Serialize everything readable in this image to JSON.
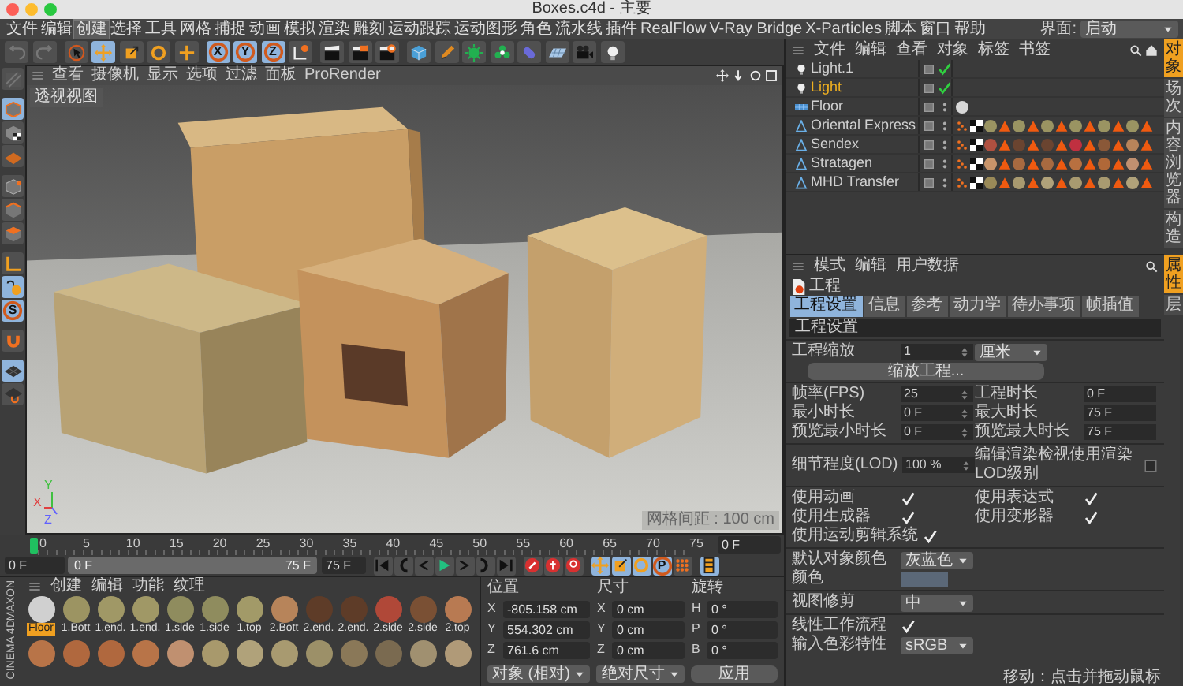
{
  "window": {
    "title": "Boxes.c4d - 主要"
  },
  "menu": [
    {
      "label": "文件",
      "selected": false
    },
    {
      "label": "编辑",
      "selected": false
    },
    {
      "label": "创建",
      "selected": true
    },
    {
      "label": "选择",
      "selected": false
    },
    {
      "label": "工具",
      "selected": false
    },
    {
      "label": "网格",
      "selected": false
    },
    {
      "label": "捕捉",
      "selected": false
    },
    {
      "label": "动画",
      "selected": false
    },
    {
      "label": "模拟",
      "selected": false
    },
    {
      "label": "渲染",
      "selected": false
    },
    {
      "label": "雕刻",
      "selected": false
    },
    {
      "label": "运动跟踪",
      "selected": false
    },
    {
      "label": "运动图形",
      "selected": false
    },
    {
      "label": "角色",
      "selected": false
    },
    {
      "label": "流水线",
      "selected": false
    },
    {
      "label": "插件",
      "selected": false
    },
    {
      "label": "RealFlow",
      "selected": false
    },
    {
      "label": "V-Ray Bridge",
      "selected": false
    },
    {
      "label": "X-Particles",
      "selected": false
    },
    {
      "label": "脚本",
      "selected": false
    },
    {
      "label": "窗口",
      "selected": false
    },
    {
      "label": "帮助",
      "selected": false
    }
  ],
  "layout_selector": {
    "label": "界面:",
    "value": "启动"
  },
  "toolbar": [
    [
      {
        "kind": "undo",
        "selected": false
      },
      {
        "kind": "redo",
        "selected": false
      }
    ],
    [
      {
        "kind": "select",
        "selected": false
      },
      {
        "kind": "move",
        "selected": true
      },
      {
        "kind": "scale",
        "selected": false
      },
      {
        "kind": "rotate",
        "selected": false
      },
      {
        "kind": "add",
        "selected": false
      }
    ],
    [
      {
        "kind": "axis",
        "label": "X",
        "selected": true
      },
      {
        "kind": "axis",
        "label": "Y",
        "selected": true
      },
      {
        "kind": "axis",
        "label": "Z",
        "selected": true
      },
      {
        "kind": "coords",
        "selected": false
      }
    ],
    [
      {
        "kind": "render-view",
        "selected": false
      },
      {
        "kind": "render-picture",
        "selected": false
      },
      {
        "kind": "render-settings",
        "selected": false
      }
    ],
    [
      {
        "kind": "cube",
        "selected": false
      },
      {
        "kind": "pen",
        "selected": false
      },
      {
        "kind": "subdivision",
        "selected": false
      },
      {
        "kind": "cloner",
        "selected": false
      },
      {
        "kind": "deformer",
        "selected": false
      },
      {
        "kind": "floor",
        "selected": false
      },
      {
        "kind": "camera",
        "selected": false
      },
      {
        "kind": "light",
        "selected": false
      }
    ]
  ],
  "left_toolbar": [
    [
      {
        "kind": "editable",
        "selected": false
      }
    ],
    [
      {
        "kind": "model",
        "selected": true
      },
      {
        "kind": "texture",
        "selected": false
      },
      {
        "kind": "workplane",
        "selected": false
      }
    ],
    [
      {
        "kind": "points",
        "selected": false
      },
      {
        "kind": "edges",
        "selected": false
      },
      {
        "kind": "polygons",
        "selected": false
      }
    ],
    [
      {
        "kind": "axis-mode",
        "selected": false
      },
      {
        "kind": "tweak",
        "selected": true
      },
      {
        "kind": "snap",
        "label": "S",
        "selected": true
      }
    ],
    [
      {
        "kind": "magnet",
        "selected": false
      }
    ],
    [
      {
        "kind": "grid-lock",
        "selected": true
      },
      {
        "kind": "grid-magnet",
        "selected": false
      }
    ]
  ],
  "viewport": {
    "menu": [
      "查看",
      "摄像机",
      "显示",
      "选项",
      "过滤",
      "面板",
      "ProRender"
    ],
    "view_label": "透视视图",
    "grid_spacing": "网格间距 : 100 cm",
    "axis_labels": [
      "Y",
      "X",
      "Z"
    ]
  },
  "timeline": {
    "ticks": [
      "0",
      "5",
      "10",
      "15",
      "20",
      "25",
      "30",
      "35",
      "40",
      "45",
      "50",
      "55",
      "60",
      "65",
      "70",
      "75"
    ],
    "playhead": {
      "level": 0
    },
    "current": "0 F",
    "start": "0 F",
    "range_start": "0 F",
    "range_end": "75 F",
    "range": {
      "level": 1
    },
    "end": "75 F",
    "buttons": [
      [
        {
          "kind": "first",
          "selected": false
        },
        {
          "kind": "prev-key",
          "selected": false
        },
        {
          "kind": "prev-frame",
          "selected": false
        },
        {
          "kind": "play",
          "selected": false
        },
        {
          "kind": "next-frame",
          "selected": false
        },
        {
          "kind": "next-key",
          "selected": false
        },
        {
          "kind": "last",
          "selected": false
        }
      ],
      [
        {
          "kind": "record",
          "selected": false
        },
        {
          "kind": "autokey",
          "selected": false
        },
        {
          "kind": "keyselection",
          "selected": false
        }
      ],
      [
        {
          "kind": "key-pos",
          "selected": true
        },
        {
          "kind": "key-scale",
          "selected": true
        },
        {
          "kind": "key-rot",
          "selected": true
        },
        {
          "kind": "axis",
          "label": "P",
          "selected": true
        },
        {
          "kind": "key-pla",
          "selected": false
        }
      ],
      [
        {
          "kind": "timeline",
          "selected": true
        }
      ]
    ]
  },
  "materials": {
    "menu": [
      "创建",
      "编辑",
      "功能",
      "纹理"
    ],
    "logo": [
      "MAXON",
      "CINEMA 4D"
    ],
    "items": [
      {
        "name": "Floor",
        "color": "#d0d0d0",
        "selected": true
      },
      {
        "name": "1.Bott",
        "color": "#9c9462",
        "selected": false
      },
      {
        "name": "1.end.",
        "color": "#a09866",
        "selected": false
      },
      {
        "name": "1.end.",
        "color": "#a09866",
        "selected": false
      },
      {
        "name": "1.side",
        "color": "#8f8c5e",
        "selected": false
      },
      {
        "name": "1.side",
        "color": "#8f8c5e",
        "selected": false
      },
      {
        "name": "1.top",
        "color": "#a29a68",
        "selected": false
      },
      {
        "name": "2.Bott",
        "color": "#b7845a",
        "selected": false
      },
      {
        "name": "2.end.",
        "color": "#5e3c28",
        "selected": false
      },
      {
        "name": "2.end.",
        "color": "#5e3c28",
        "selected": false
      },
      {
        "name": "2.side",
        "color": "#b04838",
        "selected": false
      },
      {
        "name": "2.side",
        "color": "#7a5034",
        "selected": false
      },
      {
        "name": "2.top",
        "color": "#b87a52",
        "selected": false
      }
    ],
    "row_2": [
      {
        "color": "#b87448"
      },
      {
        "color": "#b0683e"
      },
      {
        "color": "#b0683e"
      },
      {
        "color": "#b87448"
      },
      {
        "color": "#c09070"
      },
      {
        "color": "#a8996c"
      },
      {
        "color": "#b0a27a"
      },
      {
        "color": "#a89a70"
      },
      {
        "color": "#9c9068"
      },
      {
        "color": "#8a7858"
      },
      {
        "color": "#7a6a50"
      },
      {
        "color": "#a09070"
      },
      {
        "color": "#b09a78"
      }
    ]
  },
  "coordinates": {
    "headers": [
      "位置",
      "尺寸",
      "旋转"
    ],
    "rows": [
      {
        "axes": [
          "X",
          "X",
          "H"
        ],
        "values": [
          "-805.158 cm",
          "0 cm",
          "0 °"
        ]
      },
      {
        "axes": [
          "Y",
          "Y",
          "P"
        ],
        "values": [
          "554.302 cm",
          "0 cm",
          "0 °"
        ]
      },
      {
        "axes": [
          "Z",
          "Z",
          "B"
        ],
        "values": [
          "761.6 cm",
          "0 cm",
          "0 °"
        ]
      }
    ],
    "dropdowns": [
      "对象 (相对)",
      "绝对尺寸"
    ],
    "apply": "应用"
  },
  "object_manager": {
    "menu": [
      "文件",
      "编辑",
      "查看",
      "对象",
      "标签",
      "书签"
    ],
    "objects": [
      {
        "name": "Light.1",
        "kind": "light",
        "selected": false,
        "enabled": true
      },
      {
        "name": "Light",
        "kind": "light",
        "selected": true,
        "enabled": true
      },
      {
        "name": "Floor",
        "kind": "floor",
        "selected": false,
        "tags": [
          {
            "kind": "material",
            "color": "#d8d8d8"
          }
        ]
      },
      {
        "name": "Oriental Express",
        "kind": "polygon",
        "selected": false,
        "tags": [
          {
            "kind": "uvw"
          },
          {
            "kind": "texture"
          },
          {
            "kind": "material",
            "color": "#9a9462"
          },
          {
            "kind": "selection"
          },
          {
            "kind": "material",
            "color": "#9a9462"
          },
          {
            "kind": "selection"
          },
          {
            "kind": "material",
            "color": "#9a9462"
          },
          {
            "kind": "selection"
          },
          {
            "kind": "material",
            "color": "#9a9462"
          },
          {
            "kind": "selection"
          },
          {
            "kind": "material",
            "color": "#9a9462"
          },
          {
            "kind": "selection"
          },
          {
            "kind": "material",
            "color": "#9a9462"
          },
          {
            "kind": "selection"
          }
        ]
      },
      {
        "name": "Sendex",
        "kind": "polygon",
        "selected": false,
        "tags": [
          {
            "kind": "uvw"
          },
          {
            "kind": "texture"
          },
          {
            "kind": "material",
            "color": "#b05040"
          },
          {
            "kind": "selection"
          },
          {
            "kind": "material",
            "color": "#6a4430"
          },
          {
            "kind": "selection"
          },
          {
            "kind": "material",
            "color": "#6a4430"
          },
          {
            "kind": "selection"
          },
          {
            "kind": "material",
            "color": "#c03040"
          },
          {
            "kind": "selection"
          },
          {
            "kind": "material",
            "color": "#8a5838"
          },
          {
            "kind": "selection"
          },
          {
            "kind": "material",
            "color": "#b8845a"
          },
          {
            "kind": "selection"
          }
        ]
      },
      {
        "name": "Stratagen",
        "kind": "polygon",
        "selected": false,
        "tags": [
          {
            "kind": "uvw"
          },
          {
            "kind": "texture"
          },
          {
            "kind": "material",
            "color": "#c8946a"
          },
          {
            "kind": "selection"
          },
          {
            "kind": "material",
            "color": "#a86a40"
          },
          {
            "kind": "selection"
          },
          {
            "kind": "material",
            "color": "#a86a40"
          },
          {
            "kind": "selection"
          },
          {
            "kind": "material",
            "color": "#b87040"
          },
          {
            "kind": "selection"
          },
          {
            "kind": "material",
            "color": "#b06838"
          },
          {
            "kind": "selection"
          },
          {
            "kind": "material",
            "color": "#c09070"
          },
          {
            "kind": "selection"
          }
        ]
      },
      {
        "name": "MHD Transfer",
        "kind": "polygon",
        "selected": false,
        "tags": [
          {
            "kind": "uvw"
          },
          {
            "kind": "texture"
          },
          {
            "kind": "material",
            "color": "#9a8a58"
          },
          {
            "kind": "selection"
          },
          {
            "kind": "material",
            "color": "#a89a70"
          },
          {
            "kind": "selection"
          },
          {
            "kind": "material",
            "color": "#b0a27a"
          },
          {
            "kind": "selection"
          },
          {
            "kind": "material",
            "color": "#a89a70"
          },
          {
            "kind": "selection"
          },
          {
            "kind": "material",
            "color": "#a89a70"
          },
          {
            "kind": "selection"
          },
          {
            "kind": "material",
            "color": "#b0a27a"
          },
          {
            "kind": "selection"
          }
        ]
      }
    ]
  },
  "side_tabs_top": [
    {
      "label": "对象",
      "selected": true
    },
    {
      "label": "场次",
      "selected": false
    },
    {
      "label": "内容浏览器",
      "selected": false
    },
    {
      "label": "构造",
      "selected": false
    }
  ],
  "side_tabs_bottom": [
    {
      "label": "属性",
      "selected": true
    },
    {
      "label": "层",
      "selected": false
    }
  ],
  "attributes": {
    "menu": [
      "模式",
      "编辑",
      "用户数据"
    ],
    "title": "工程",
    "tabs": [
      {
        "label": "工程设置",
        "selected": true
      },
      {
        "label": "信息",
        "selected": false
      },
      {
        "label": "参考",
        "selected": false
      },
      {
        "label": "动力学",
        "selected": false
      },
      {
        "label": "待办事项",
        "selected": false
      },
      {
        "label": "帧插值",
        "selected": false
      }
    ],
    "section": "工程设置",
    "groups": [
      [
        [
          {
            "kind": "number",
            "label": "工程缩放",
            "value": "1"
          },
          {
            "kind": "dropdown",
            "value": "厘米"
          }
        ],
        [
          {
            "kind": "button",
            "label": "缩放工程..."
          }
        ]
      ],
      [
        [
          {
            "kind": "number",
            "label": "帧率(FPS)",
            "value": "25"
          },
          {
            "kind": "text",
            "label": "工程时长",
            "value": "0 F"
          }
        ],
        [
          {
            "kind": "number",
            "label": "最小时长",
            "value": "0 F"
          },
          {
            "kind": "text",
            "label": "最大时长",
            "value": "75 F"
          }
        ],
        [
          {
            "kind": "number",
            "label": "预览最小时长",
            "value": "0 F"
          },
          {
            "kind": "text",
            "label": "预览最大时长",
            "value": "75 F"
          }
        ]
      ],
      [
        [
          {
            "kind": "number",
            "label": "细节程度(LOD)",
            "value": "100 %"
          },
          {
            "kind": "check",
            "label": "编辑渲染检视使用渲染LOD级别",
            "checked": false
          }
        ]
      ],
      [
        [
          {
            "kind": "check",
            "label": "使用动画",
            "checked": true
          },
          {
            "kind": "check",
            "label": "使用表达式",
            "checked": true
          }
        ],
        [
          {
            "kind": "check",
            "label": "使用生成器",
            "checked": true
          },
          {
            "kind": "check",
            "label": "使用变形器",
            "checked": true
          }
        ],
        [
          {
            "kind": "check",
            "label": "使用运动剪辑系统",
            "checked": true
          }
        ]
      ],
      [
        [
          {
            "kind": "dropdown",
            "label": "默认对象颜色",
            "value": "灰蓝色"
          }
        ],
        [
          {
            "kind": "color",
            "label": "颜色",
            "color": "#5b6878"
          }
        ]
      ],
      [
        [
          {
            "kind": "dropdown",
            "label": "视图修剪",
            "value": "中"
          }
        ]
      ],
      [
        [
          {
            "kind": "check",
            "label": "线性工作流程",
            "checked": true
          }
        ],
        [
          {
            "kind": "dropdown",
            "label": "输入色彩特性",
            "value": "sRGB"
          }
        ]
      ]
    ]
  },
  "status_bar": "移动：点击并拖动鼠标"
}
